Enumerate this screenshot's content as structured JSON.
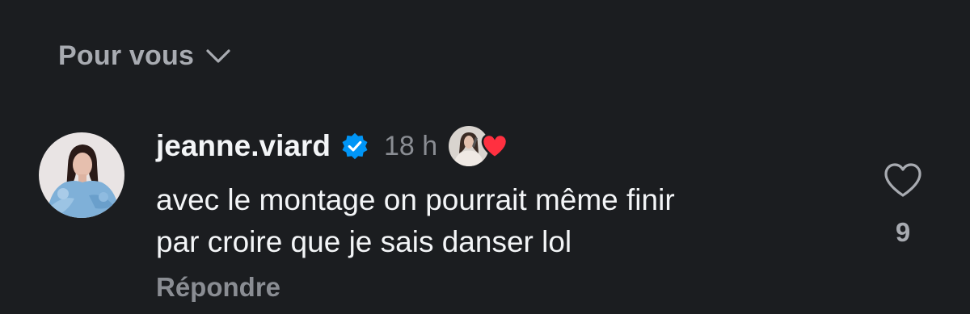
{
  "sort": {
    "label": "Pour vous",
    "chevron_icon": "chevron-down-icon"
  },
  "comment": {
    "username": "jeanne.viard",
    "verified_icon": "verified-badge-icon",
    "timestamp": "18 h",
    "text": "avec le montage on pourrait même finir\npar croire que je sais danser lol",
    "reply_label": "Répondre",
    "like_icon": "heart-outline-icon",
    "like_count": "9",
    "liked_by_creator_icon": "red-heart-icon"
  },
  "colors": {
    "background": "#1b1d20",
    "primary_text": "#f3f5f7",
    "secondary_text": "#8a8d93",
    "verified_blue": "#0095f6",
    "heart_red": "#ff3040"
  }
}
